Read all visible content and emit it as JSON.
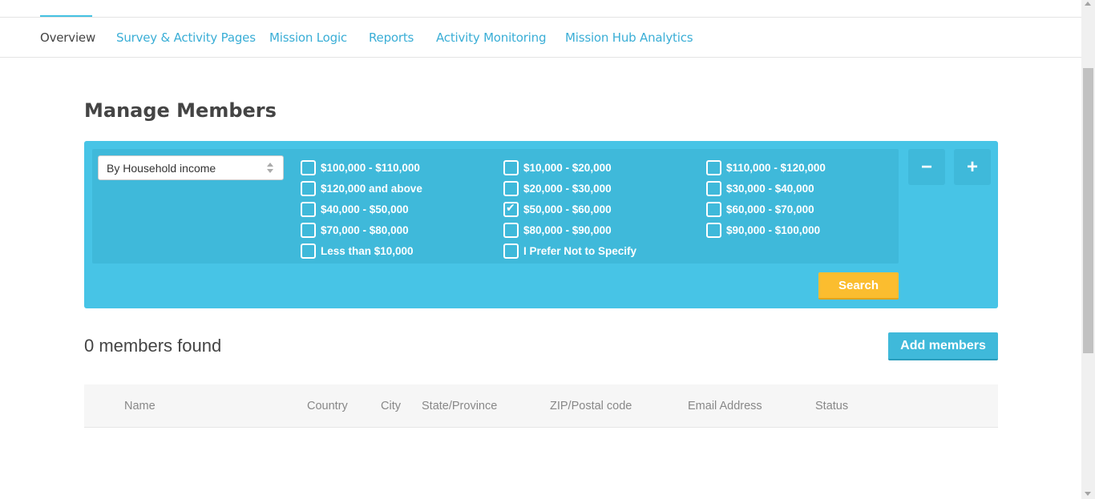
{
  "nav": {
    "tabs": [
      {
        "label": "Overview",
        "active": true
      },
      {
        "label": "Survey & Activity Pages"
      },
      {
        "label": "Mission Logic"
      },
      {
        "label": "Reports"
      },
      {
        "label": "Activity Monitoring"
      },
      {
        "label": "Mission Hub Analytics"
      }
    ]
  },
  "page": {
    "title": "Manage Members"
  },
  "filter": {
    "selected_filter": "By Household income",
    "options": [
      {
        "label": "$100,000 - $110,000",
        "checked": false
      },
      {
        "label": "$10,000 - $20,000",
        "checked": false
      },
      {
        "label": "$110,000 - $120,000",
        "checked": false
      },
      {
        "label": "$120,000 and above",
        "checked": false
      },
      {
        "label": "$20,000 - $30,000",
        "checked": false
      },
      {
        "label": "$30,000 - $40,000",
        "checked": false
      },
      {
        "label": "$40,000 - $50,000",
        "checked": false
      },
      {
        "label": "$50,000 - $60,000",
        "checked": true
      },
      {
        "label": "$60,000 - $70,000",
        "checked": false
      },
      {
        "label": "$70,000 - $80,000",
        "checked": false
      },
      {
        "label": "$80,000 - $90,000",
        "checked": false
      },
      {
        "label": "$90,000 - $100,000",
        "checked": false
      },
      {
        "label": "Less than $10,000",
        "checked": false
      },
      {
        "label": "I Prefer Not to Specify",
        "checked": false
      }
    ],
    "remove_label": "−",
    "add_label": "+",
    "search_label": "Search"
  },
  "results": {
    "count_text": "0 members found",
    "add_members_label": "Add members"
  },
  "table": {
    "columns": [
      "Name",
      "Country",
      "City",
      "State/Province",
      "ZIP/Postal code",
      "Email Address",
      "Status"
    ]
  },
  "colors": {
    "accent": "#47c4e6",
    "accent_dark": "#3fb9da",
    "search_button": "#fbbd2f",
    "link": "#3aaed6"
  }
}
